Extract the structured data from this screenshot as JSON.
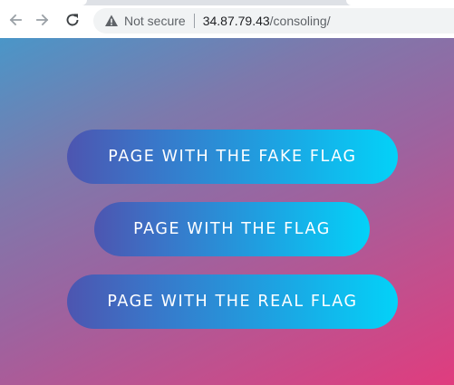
{
  "browser": {
    "security_label": "Not secure",
    "url_host": "34.87.79.43",
    "url_path": "/consoling/",
    "icons": {
      "back": "arrow-left-icon",
      "forward": "arrow-right-icon",
      "reload": "reload-icon",
      "security": "warning-triangle-icon"
    }
  },
  "page": {
    "buttons": [
      {
        "label": "PAGE WITH THE FAKE FLAG"
      },
      {
        "label": "PAGE WITH THE FLAG"
      },
      {
        "label": "PAGE WITH THE REAL FLAG"
      }
    ]
  },
  "colors": {
    "background_gradient": [
      "#4a96c8",
      "#9b64a0",
      "#e03c7e"
    ],
    "button_gradient": [
      "#4d55b0",
      "#03d2f8"
    ],
    "button_text": "#ffffff"
  }
}
